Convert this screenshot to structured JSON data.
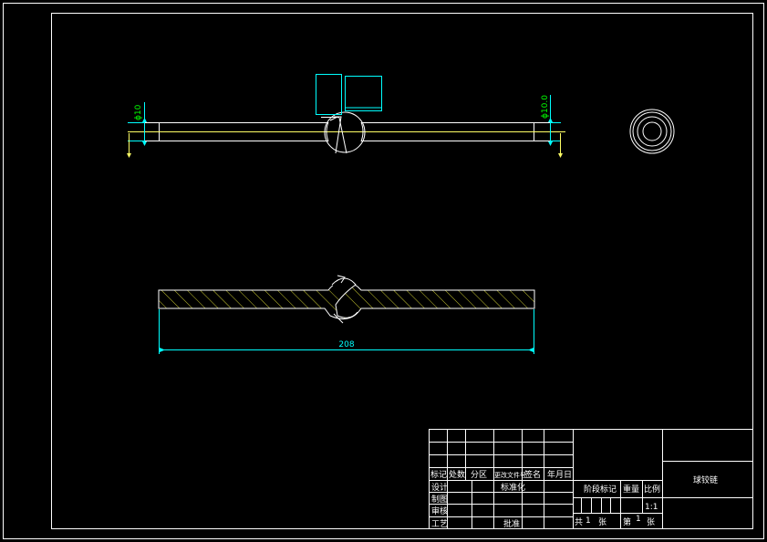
{
  "drawing": {
    "title": "球铰链",
    "dimensions": {
      "diameter_left": "ϕ10",
      "diameter_right": "ϕ10.0",
      "overall_length": "208"
    }
  },
  "title_block": {
    "headers": [
      "标记",
      "处数",
      "分区",
      "更改文件号",
      "签名",
      "年月日"
    ],
    "roles": [
      "设计",
      "制图",
      "审核",
      "工艺"
    ],
    "standardize": "标准化",
    "approve": "批准",
    "stage_mark": "阶段标记",
    "weight": "重量",
    "scale_label": "比例",
    "scale_value": "1:1",
    "sheets_total_pre": "共",
    "sheets_total": "1",
    "sheets_unit": "张",
    "sheet_no_pre": "第",
    "sheet_no": "1",
    "sheet_no_unit": "张"
  },
  "colors": {
    "background": "#000000",
    "outline": "#ffffff",
    "part": "#ffff66",
    "dimension": "#00ffff",
    "dim_text": "#00ff00",
    "hatch": "#cccc33"
  }
}
